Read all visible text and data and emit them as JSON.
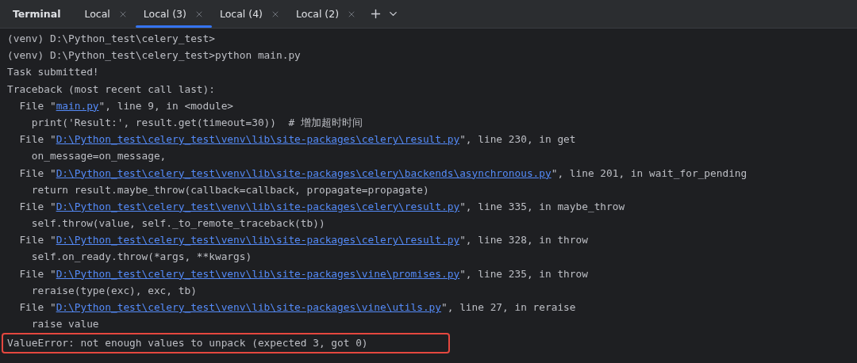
{
  "panel": {
    "title": "Terminal"
  },
  "tabs": [
    {
      "label": "Local",
      "selected": false
    },
    {
      "label": "Local (3)",
      "selected": true
    },
    {
      "label": "Local (4)",
      "selected": false
    },
    {
      "label": "Local (2)",
      "selected": false
    }
  ],
  "lines": [
    {
      "highlighted": false,
      "segments": [
        {
          "kind": "text",
          "text": "(venv) D:\\Python_test\\celery_test>"
        }
      ]
    },
    {
      "highlighted": false,
      "segments": [
        {
          "kind": "text",
          "text": "(venv) D:\\Python_test\\celery_test>python main.py"
        }
      ]
    },
    {
      "highlighted": false,
      "segments": [
        {
          "kind": "text",
          "text": "Task submitted!"
        }
      ]
    },
    {
      "highlighted": false,
      "segments": [
        {
          "kind": "text",
          "text": "Traceback (most recent call last):"
        }
      ]
    },
    {
      "highlighted": false,
      "segments": [
        {
          "kind": "text",
          "text": "  File \""
        },
        {
          "kind": "link",
          "text": "main.py"
        },
        {
          "kind": "text",
          "text": "\", line 9, in <module>"
        }
      ]
    },
    {
      "highlighted": false,
      "segments": [
        {
          "kind": "text",
          "text": "    print('Result:', result.get(timeout=30))  # 增加超时时间"
        }
      ]
    },
    {
      "highlighted": false,
      "segments": [
        {
          "kind": "text",
          "text": "  File \""
        },
        {
          "kind": "link",
          "text": "D:\\Python_test\\celery_test\\venv\\lib\\site-packages\\celery\\result.py"
        },
        {
          "kind": "text",
          "text": "\", line 230, in get"
        }
      ]
    },
    {
      "highlighted": false,
      "segments": [
        {
          "kind": "text",
          "text": "    on_message=on_message,"
        }
      ]
    },
    {
      "highlighted": false,
      "segments": [
        {
          "kind": "text",
          "text": "  File \""
        },
        {
          "kind": "link",
          "text": "D:\\Python_test\\celery_test\\venv\\lib\\site-packages\\celery\\backends\\asynchronous.py"
        },
        {
          "kind": "text",
          "text": "\", line 201, in wait_for_pending"
        }
      ]
    },
    {
      "highlighted": false,
      "segments": [
        {
          "kind": "text",
          "text": "    return result.maybe_throw(callback=callback, propagate=propagate)"
        }
      ]
    },
    {
      "highlighted": false,
      "segments": [
        {
          "kind": "text",
          "text": "  File \""
        },
        {
          "kind": "link",
          "text": "D:\\Python_test\\celery_test\\venv\\lib\\site-packages\\celery\\result.py"
        },
        {
          "kind": "text",
          "text": "\", line 335, in maybe_throw"
        }
      ]
    },
    {
      "highlighted": false,
      "segments": [
        {
          "kind": "text",
          "text": "    self.throw(value, self._to_remote_traceback(tb))"
        }
      ]
    },
    {
      "highlighted": false,
      "segments": [
        {
          "kind": "text",
          "text": "  File \""
        },
        {
          "kind": "link",
          "text": "D:\\Python_test\\celery_test\\venv\\lib\\site-packages\\celery\\result.py"
        },
        {
          "kind": "text",
          "text": "\", line 328, in throw"
        }
      ]
    },
    {
      "highlighted": false,
      "segments": [
        {
          "kind": "text",
          "text": "    self.on_ready.throw(*args, **kwargs)"
        }
      ]
    },
    {
      "highlighted": false,
      "segments": [
        {
          "kind": "text",
          "text": "  File \""
        },
        {
          "kind": "link",
          "text": "D:\\Python_test\\celery_test\\venv\\lib\\site-packages\\vine\\promises.py"
        },
        {
          "kind": "text",
          "text": "\", line 235, in throw"
        }
      ]
    },
    {
      "highlighted": false,
      "segments": [
        {
          "kind": "text",
          "text": "    reraise(type(exc), exc, tb)"
        }
      ]
    },
    {
      "highlighted": false,
      "segments": [
        {
          "kind": "text",
          "text": "  File \""
        },
        {
          "kind": "link",
          "text": "D:\\Python_test\\celery_test\\venv\\lib\\site-packages\\vine\\utils.py"
        },
        {
          "kind": "text",
          "text": "\", line 27, in reraise"
        }
      ]
    },
    {
      "highlighted": false,
      "segments": [
        {
          "kind": "text",
          "text": "    raise value"
        }
      ]
    },
    {
      "highlighted": true,
      "segments": [
        {
          "kind": "text",
          "text": "ValueError: not enough values to unpack (expected 3, got 0)"
        }
      ]
    }
  ]
}
